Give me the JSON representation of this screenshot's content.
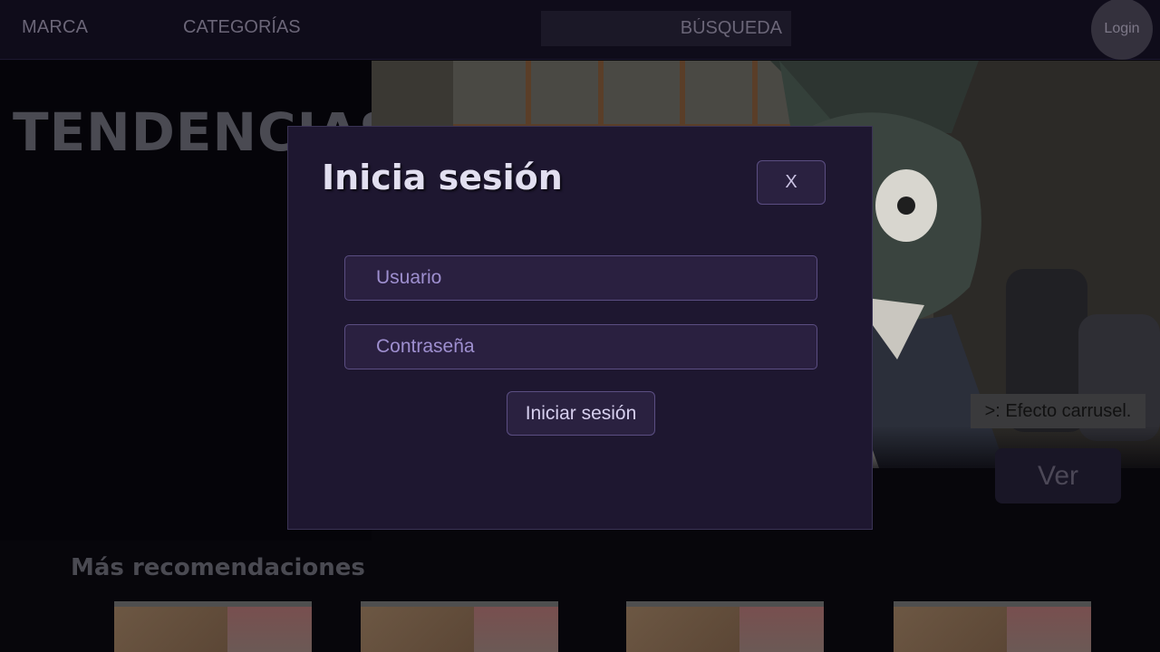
{
  "navbar": {
    "brand": "MARCA",
    "categories": "CATEGORÍAS",
    "search_placeholder": "BÚSQUEDA",
    "login": "Login"
  },
  "hero": {
    "title": "TENDENCIAS",
    "carousel_note": ">: Efecto carrusel.",
    "watch_label": "Ver"
  },
  "recommendations": {
    "title": "Más recomendaciones",
    "count_visible": 4
  },
  "login_modal": {
    "title": "Inicia sesión",
    "close_label": "X",
    "username_placeholder": "Usuario",
    "username_value": "",
    "password_placeholder": "Contraseña",
    "password_value": "",
    "submit_label": "Iniciar sesión"
  },
  "colors": {
    "page_bg": "#07060b",
    "modal_bg": "#1e1730",
    "accent_border": "#5b4e82",
    "field_text": "#9e8fcf"
  }
}
